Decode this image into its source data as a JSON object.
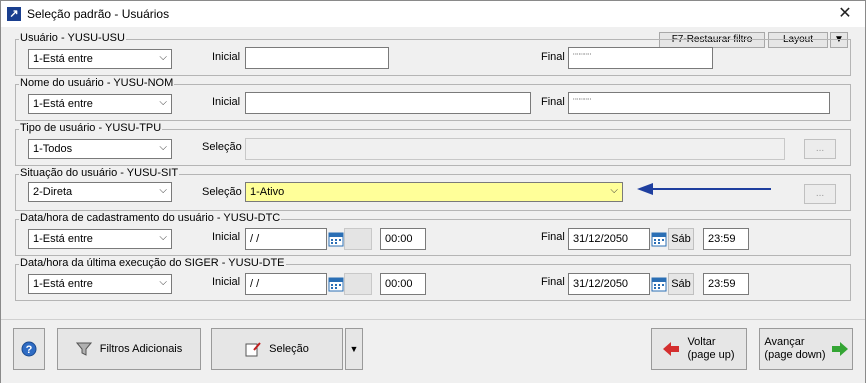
{
  "window": {
    "title": "Seleção padrão - Usuários"
  },
  "toolbar": {
    "restore_filter": "F7-Restaurar filtro",
    "layout": "Layout"
  },
  "labels": {
    "inicial": "Inicial",
    "final": "Final",
    "selecao": "Seleção"
  },
  "groups": {
    "usuario": {
      "title": "Usuário - YUSU-USU",
      "operator": "1-Está entre",
      "inicial": "",
      "final": "¨¨¨¨¨"
    },
    "nome": {
      "title": "Nome do usuário - YUSU-NOM",
      "operator": "1-Está entre",
      "inicial": "",
      "final": "¨¨¨¨¨"
    },
    "tipo": {
      "title": "Tipo de usuário - YUSU-TPU",
      "operator": "1-Todos",
      "selecao": "",
      "button": "..."
    },
    "situacao": {
      "title": "Situação do usuário - YUSU-SIT",
      "operator": "2-Direta",
      "selecao": "1-Ativo",
      "button": "..."
    },
    "cadastro": {
      "title": "Data/hora de cadastramento do usuário - YUSU-DTC",
      "operator": "1-Está entre",
      "inicial_date": "/ /",
      "inicial_time": "00:00",
      "final_date": "31/12/2050",
      "final_dow": "Sáb",
      "final_time": "23:59"
    },
    "execucao": {
      "title": "Data/hora da última execução do SIGER - YUSU-DTE",
      "operator": "1-Está entre",
      "inicial_date": "/ /",
      "inicial_time": "00:00",
      "final_date": "31/12/2050",
      "final_dow": "Sáb",
      "final_time": "23:59"
    }
  },
  "bottom": {
    "filtros_adicionais": "Filtros Adicionais",
    "selecao": "Seleção",
    "voltar": "Voltar",
    "voltar_sub": "(page up)",
    "avancar": "Avançar",
    "avancar_sub": "(page down)"
  },
  "colors": {
    "highlight": "#ffff99",
    "arrow": "#1f3f9f"
  },
  "icons": [
    "app-icon",
    "close-icon",
    "chevron-down-icon",
    "calendar-icon",
    "help-icon",
    "filter-icon",
    "selection-icon",
    "arrow-left-icon",
    "arrow-right-icon"
  ]
}
